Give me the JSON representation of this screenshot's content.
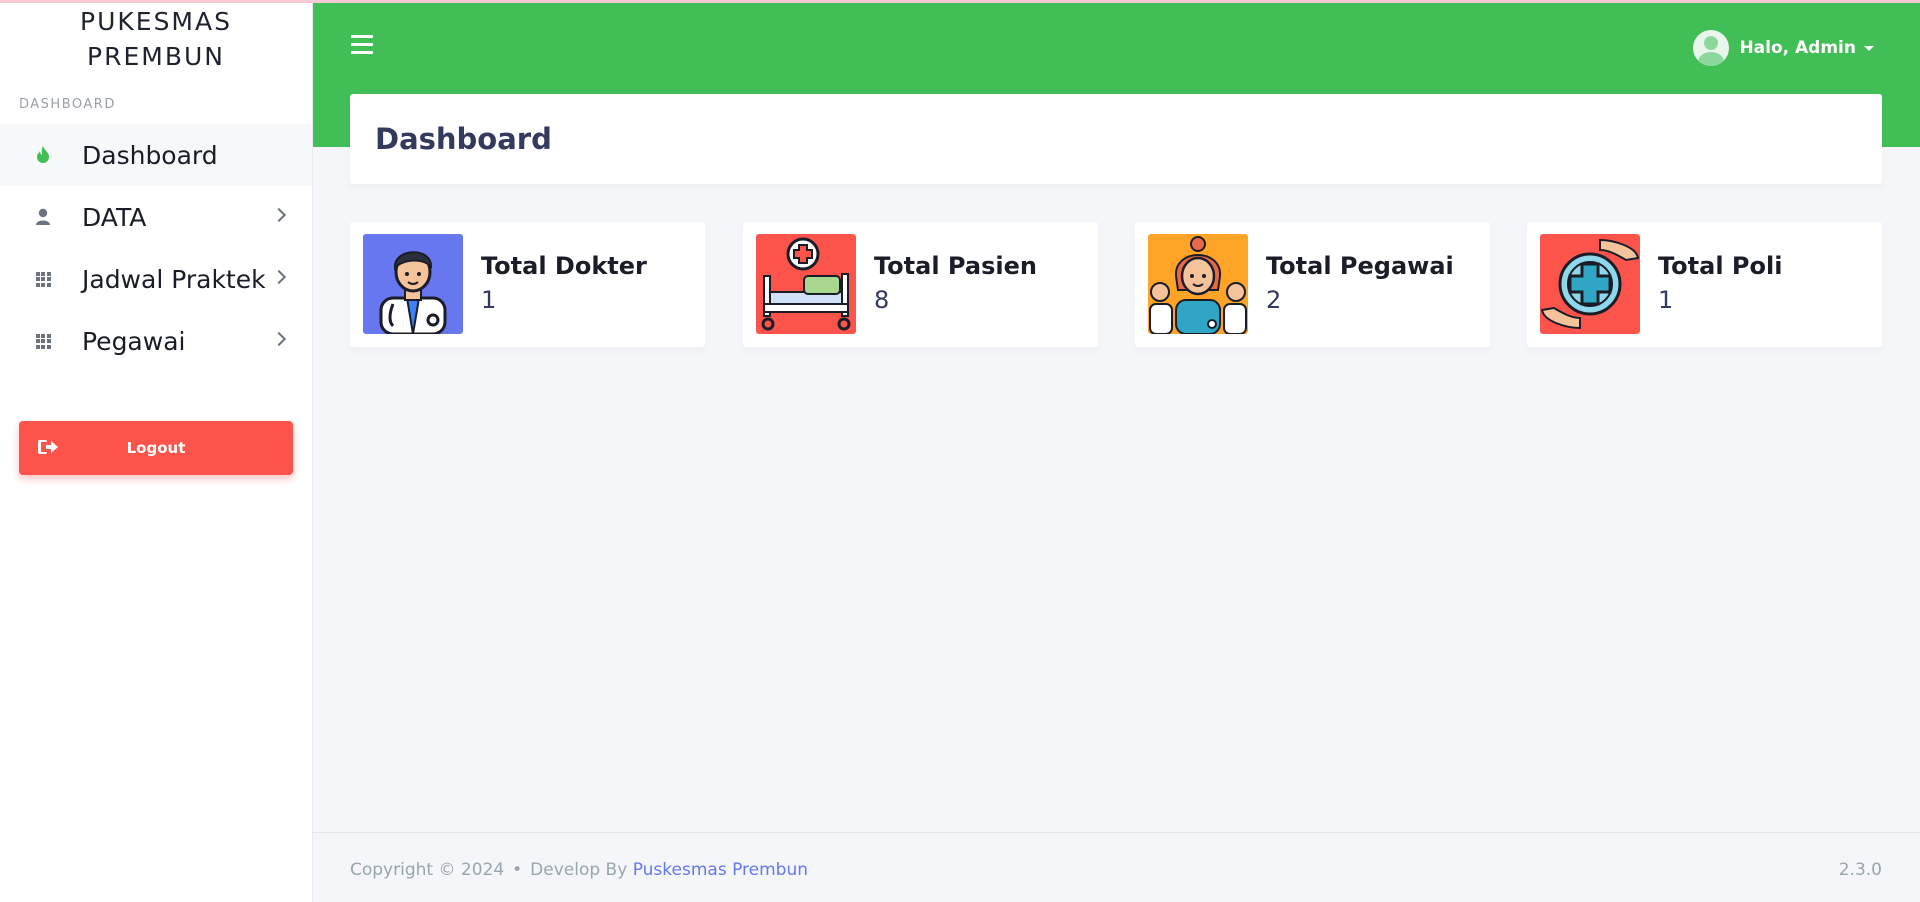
{
  "brand": {
    "line1": "PUKESMAS",
    "line2": "PREMBUN"
  },
  "sidebar": {
    "header": "DASHBOARD",
    "items": [
      {
        "label": "Dashboard",
        "icon": "fire-icon",
        "active": true
      },
      {
        "label": "DATA",
        "icon": "user-icon",
        "has_submenu": true
      },
      {
        "label": "Jadwal Praktek",
        "icon": "grid-icon",
        "has_submenu": true
      },
      {
        "label": "Pegawai",
        "icon": "grid-icon",
        "has_submenu": true
      }
    ],
    "logout_label": "Logout"
  },
  "navbar": {
    "user_greeting": "Halo, Admin",
    "color": "#42be57"
  },
  "page": {
    "title": "Dashboard"
  },
  "cards": [
    {
      "title": "Total Dokter",
      "value": "1",
      "icon": "doctor-icon",
      "color": "#6777ef"
    },
    {
      "title": "Total Pasien",
      "value": "8",
      "icon": "hospital-bed-icon",
      "color": "#fc544b"
    },
    {
      "title": "Total Pegawai",
      "value": "2",
      "icon": "staff-icon",
      "color": "#ffa426"
    },
    {
      "title": "Total Poli",
      "value": "1",
      "icon": "medical-care-icon",
      "color": "#fc544b"
    }
  ],
  "footer": {
    "copyright": "Copyright © 2024",
    "separator": "•",
    "develop_prefix": "Develop By",
    "develop_link": "Puskesmas Prembun",
    "version": "2.3.0"
  }
}
